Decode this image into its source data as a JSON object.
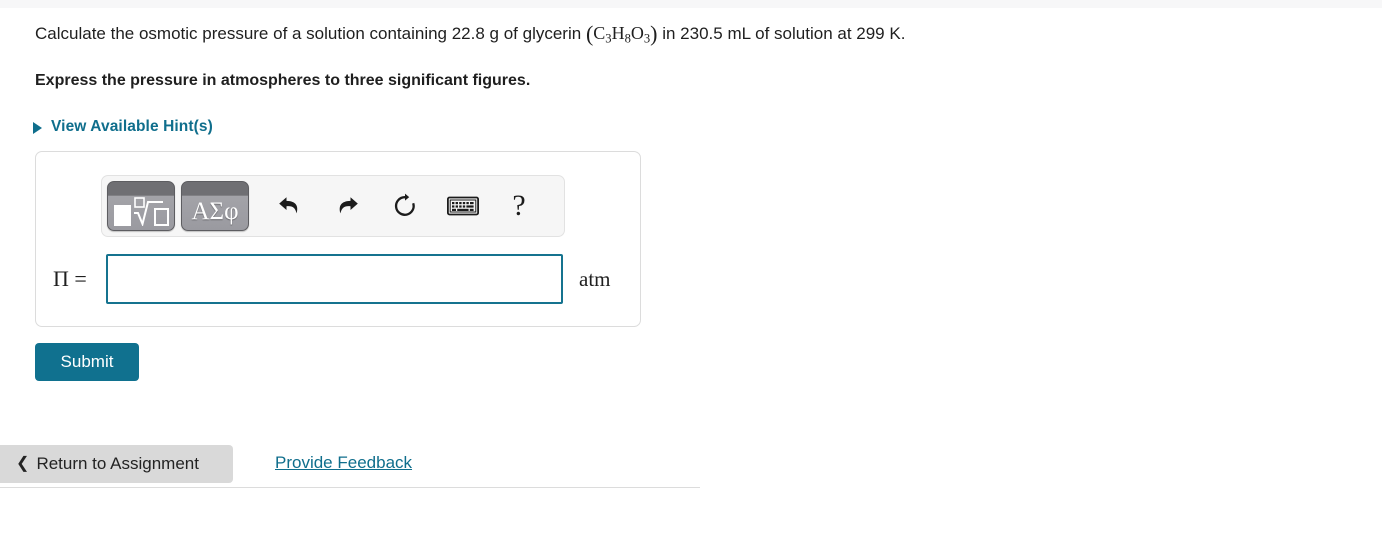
{
  "question": {
    "text_before_formula": "Calculate the osmotic pressure of a solution containing 22.8 g of glycerin ",
    "formula": "C3H8O3",
    "formula_parts": [
      {
        "element": "C",
        "sub": "3"
      },
      {
        "element": "H",
        "sub": "8"
      },
      {
        "element": "O",
        "sub": "3"
      }
    ],
    "text_after_formula": " in 230.5 mL of solution at 299 K.",
    "mass_value": "22.8 g",
    "volume_value": "230.5 mL",
    "temperature_value": "299 K",
    "instruction": "Express the pressure in atmospheres to three significant figures."
  },
  "hints": {
    "label": "View Available Hint(s)",
    "icon": "triangle-right-icon",
    "color": "#0f6e8c"
  },
  "answer_area": {
    "toolbar": {
      "template_button": {
        "name": "math-template-button",
        "icon": "square-root-template-icon"
      },
      "greek_button": {
        "name": "greek-symbols-button",
        "label": "ΑΣφ"
      },
      "undo": {
        "name": "undo-icon",
        "title": "Undo"
      },
      "redo": {
        "name": "redo-icon",
        "title": "Redo"
      },
      "reset": {
        "name": "reset-icon",
        "title": "Reset"
      },
      "keyboard": {
        "name": "keyboard-icon",
        "title": "Keyboard shortcuts"
      },
      "help": {
        "name": "help-icon",
        "label": "?"
      }
    },
    "variable_label": "Π =",
    "input_value": "",
    "input_placeholder": "",
    "unit": "atm"
  },
  "actions": {
    "submit_label": "Submit",
    "submit_color": "#10718f"
  },
  "footer": {
    "return_chevron": "❮",
    "return_label": "Return to Assignment",
    "feedback_label": "Provide Feedback",
    "link_color": "#0f6e8c"
  }
}
